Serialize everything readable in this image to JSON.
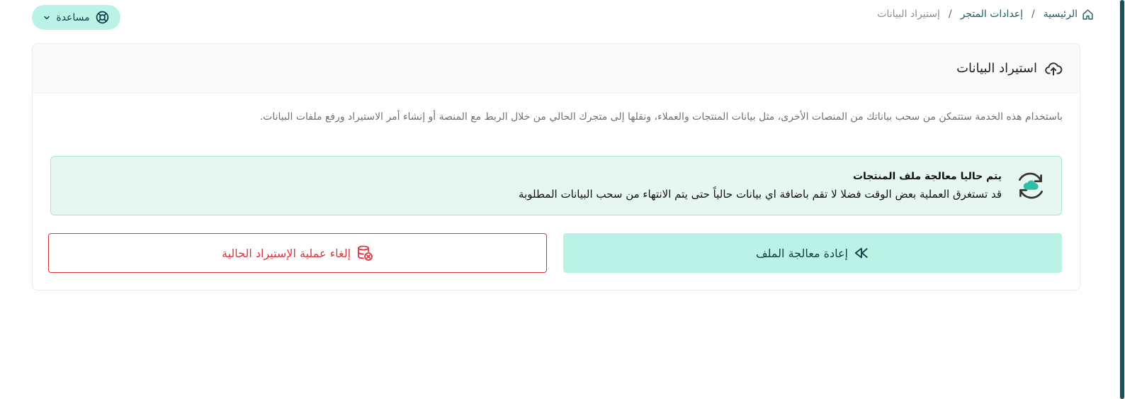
{
  "breadcrumb": {
    "home": "الرئيسية",
    "store_settings": "إعدادات المتجر",
    "current": "إستيراد البيانات",
    "separator": "/"
  },
  "help": {
    "label": "مساعدة",
    "icon": "lifebuoy-icon"
  },
  "card": {
    "title": "استيراد البيانات",
    "title_icon": "cloud-upload-icon",
    "description": "باستخدام هذه الخدمة ستتمكن من سحب بياناتك من المنصات الأخرى، مثل بيانات المنتجات والعملاء، ونقلها إلى متجرك الحالي من خلال الربط مع المنصة أو إنشاء أمر الاستيراد ورفع ملفات البيانات."
  },
  "notice": {
    "title": "يتم حاليا معالجة ملف المنتجات",
    "body": "قد تستغرق العملية بعض الوقت فضلا لا تقم باضافة اي بيانات حالياً حتى يتم الانتهاء من سحب البيانات المطلوبة",
    "icon": "cloud-sync-icon"
  },
  "actions": {
    "reprocess_label": "إعادة معالجة الملف",
    "cancel_label": "إلغاء عملية الإستيراد الحالية"
  },
  "colors": {
    "accent": "#baf3e6",
    "accent_text": "#0f3e45",
    "danger": "#e0353d",
    "notice_bg": "#e6f7f1",
    "notice_border": "#a8e6d6"
  }
}
